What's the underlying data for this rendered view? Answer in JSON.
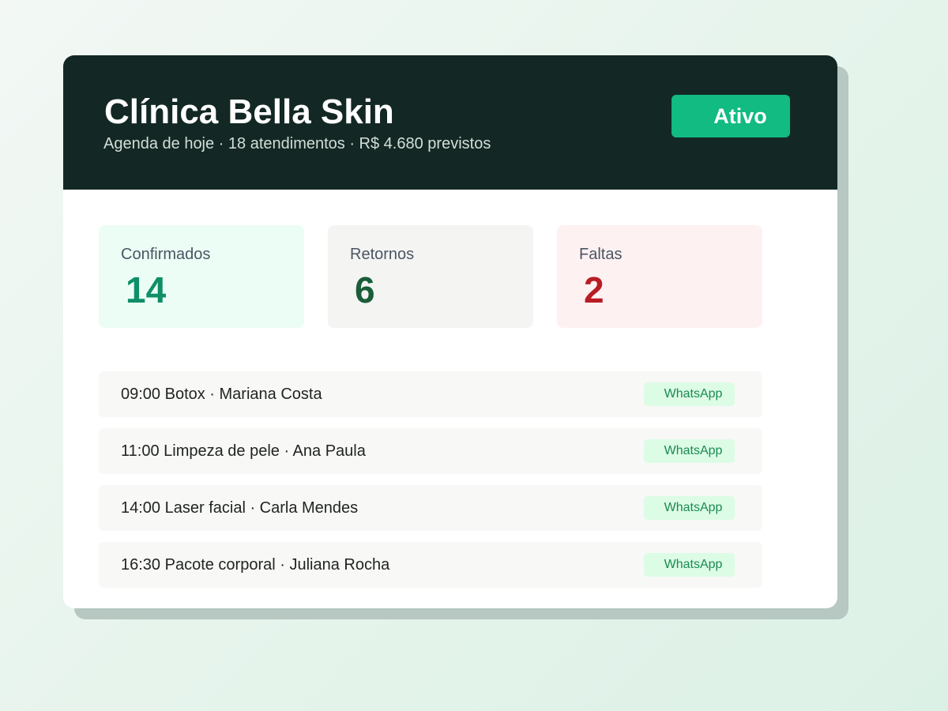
{
  "header": {
    "title": "Clínica Bella Skin",
    "subtitle": "Agenda de hoje · 18 atendimentos · R$ 4.680 previstos",
    "status_label": "Ativo"
  },
  "stats": [
    {
      "label": "Confirmados",
      "value": "14",
      "color": "#0f8e68"
    },
    {
      "label": "Retornos",
      "value": "6",
      "color": "#1a5d39"
    },
    {
      "label": "Faltas",
      "value": "2",
      "color": "#b81c24"
    }
  ],
  "appointments": [
    {
      "text": "09:00 Botox · Mariana Costa",
      "action_label": "WhatsApp"
    },
    {
      "text": "11:00 Limpeza de pele · Ana Paula",
      "action_label": "WhatsApp"
    },
    {
      "text": "14:00 Laser facial · Carla Mendes",
      "action_label": "WhatsApp"
    },
    {
      "text": "16:30 Pacote corporal · Juliana Rocha",
      "action_label": "WhatsApp"
    }
  ],
  "colors": {
    "header_background": "#132824",
    "accent": "#11bb82",
    "whatsapp_text": "#1b8a4f"
  }
}
